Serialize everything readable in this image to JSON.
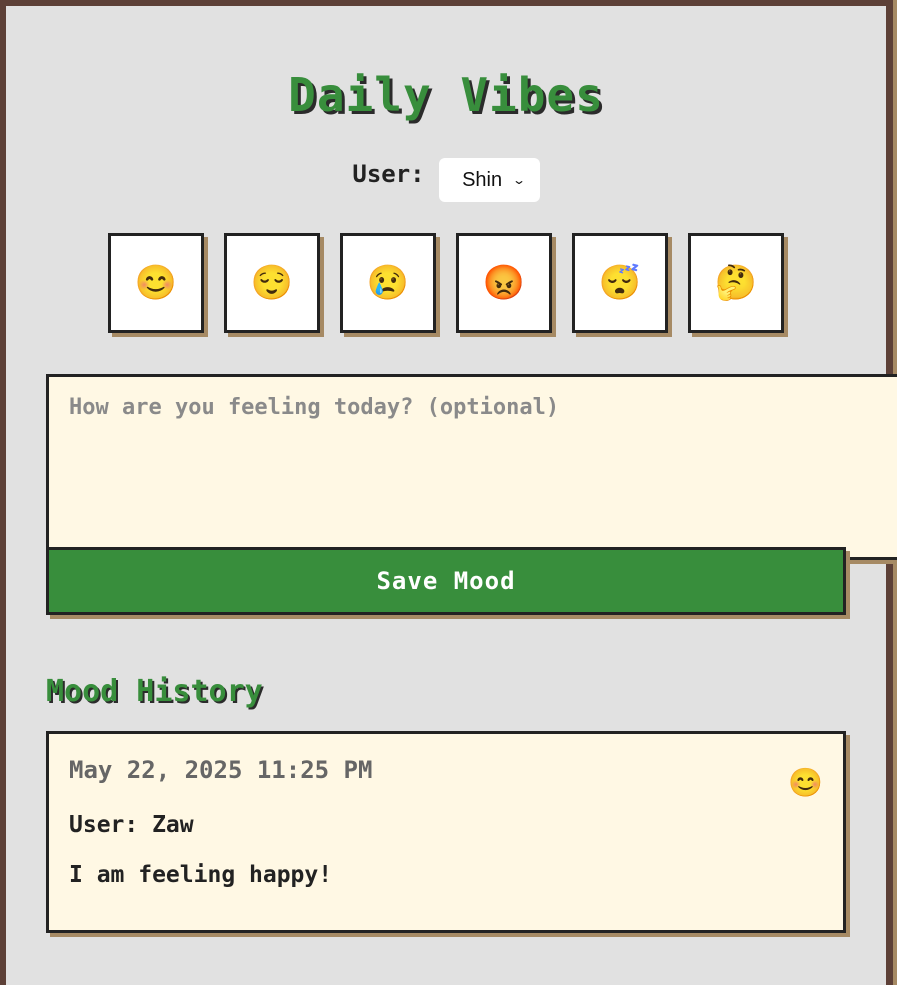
{
  "app": {
    "title": "Daily Vibes"
  },
  "user_picker": {
    "label": "User:",
    "selected": "Shin",
    "chevron_icon": "chevron-down-icon"
  },
  "moods": [
    {
      "emoji": "😊",
      "icon": "smiling-face-icon"
    },
    {
      "emoji": "😌",
      "icon": "relieved-face-icon"
    },
    {
      "emoji": "😢",
      "icon": "crying-face-icon"
    },
    {
      "emoji": "😡",
      "icon": "angry-face-icon"
    },
    {
      "emoji": "😴",
      "icon": "sleeping-face-icon"
    },
    {
      "emoji": "🤔",
      "icon": "thinking-face-icon"
    }
  ],
  "note_field": {
    "placeholder": "How are you feeling today? (optional)",
    "value": ""
  },
  "save_button": {
    "label": "Save Mood"
  },
  "history": {
    "title": "Mood History",
    "entries": [
      {
        "date": "May 22, 2025 11:25 PM",
        "user": "User: Zaw",
        "note": "I am feeling happy!",
        "emoji": "😊"
      }
    ]
  },
  "colors": {
    "accent_green": "#388e3c",
    "frame_brown": "#5d4037",
    "shadow_tan": "#a68a64",
    "panel_cream": "#fff8e4",
    "background_gray": "#e1e1e1"
  }
}
